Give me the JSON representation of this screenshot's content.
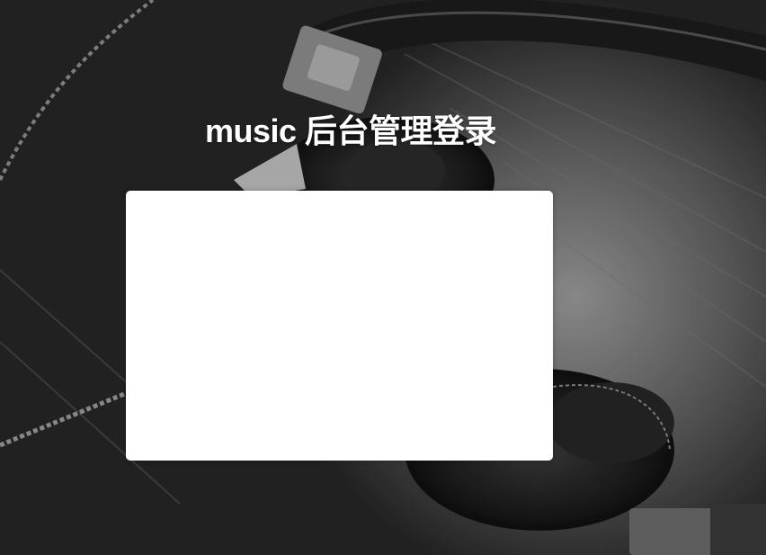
{
  "page": {
    "title": "music 后台管理登录"
  },
  "background": {
    "description_icon": "headphones-photo",
    "tone": "grayscale"
  },
  "colors": {
    "title_text": "#ffffff",
    "card_background": "#ffffff",
    "page_background": "#2a2a2a"
  }
}
